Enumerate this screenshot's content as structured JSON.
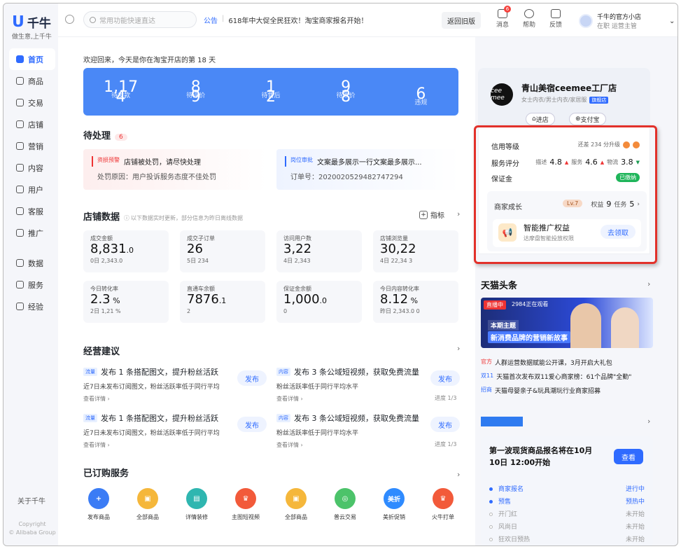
{
  "sidebar": {
    "logo_text": "千牛",
    "slogan": "做生意,上千牛",
    "items": [
      {
        "label": "首页"
      },
      {
        "label": "商品"
      },
      {
        "label": "交易"
      },
      {
        "label": "店铺"
      },
      {
        "label": "营销"
      },
      {
        "label": "内容"
      },
      {
        "label": "用户"
      },
      {
        "label": "客服"
      },
      {
        "label": "推广"
      },
      {
        "label": "数据"
      },
      {
        "label": "服务"
      },
      {
        "label": "经验"
      }
    ],
    "about": "关于千牛",
    "copyright_1": "Copyright",
    "copyright_2": "© Alibaba Group"
  },
  "topbar": {
    "search_placeholder": "常用功能快速直达",
    "notice_tag": "公告",
    "notice_text": "618年中大促全民狂欢！淘宝商家报名开始！",
    "old_version": "返回旧版",
    "messages": "消息",
    "messages_badge": "6",
    "help": "帮助",
    "feedback": "反馈",
    "user_shop": "千牛的官方小店",
    "user_status": "在职",
    "user_role": "运营主管"
  },
  "main": {
    "welcome": "欢迎回来，今天是你在淘宝开店的第 18 天",
    "banner": [
      {
        "v1": "1,17",
        "v2": "4",
        "label": "待发款"
      },
      {
        "v1": "8",
        "v2": "9",
        "label": "待评价"
      },
      {
        "v1": "1",
        "v2": "2",
        "label": "待售后"
      },
      {
        "v1": "9",
        "v2": "8",
        "label": "待改价"
      },
      {
        "v1": "6",
        "v2": "",
        "label": "违规"
      }
    ],
    "pending_title": "待处理",
    "pending_count": "6",
    "alert1": {
      "tag": "资损预警",
      "title": "店铺被处罚，请尽快处理",
      "detail": "处罚原因：用户投诉服务态度不佳处罚"
    },
    "alert2": {
      "tag": "岗位审批",
      "title": "文案最多展示一行文案最多展示...",
      "detail": "订单号：2020020529482747294"
    },
    "stats_title": "店铺数据",
    "stats_note": "以下数据实时更新，部分信息为昨日离线数据",
    "metric_btn": "指标",
    "cards": [
      {
        "label": "成交金额",
        "value": "8,831",
        "dec": ".0",
        "s1": "0",
        "s2": "日 2,343.0"
      },
      {
        "label": "成交子订单",
        "value": "26",
        "dec": "",
        "s1": "5",
        "s2": "日 234"
      },
      {
        "label": "访问用户数",
        "value": "3,22",
        "dec": "",
        "s1": "4",
        "s2": "日 2,343"
      },
      {
        "label": "店铺浏览量",
        "value": "30,22",
        "dec": "",
        "s1": "4",
        "s2": "日 22,34 3"
      },
      {
        "label": "今日转化率",
        "value": "2.3",
        "dec": " %",
        "s1": "2",
        "s2": "日 1,21 %"
      },
      {
        "label": "直通车余额",
        "value": "7876",
        "dec": ".1",
        "s1": "2",
        "s2": ""
      },
      {
        "label": "保证金余额",
        "value": "1,000",
        "dec": ".0",
        "s1": "0",
        "s2": ""
      },
      {
        "label": "今日内容转化率",
        "value": "8.12",
        "dec": " %",
        "s1": "",
        "s2": "昨日 2,343.0 0"
      }
    ],
    "advice_title": "经营建议",
    "advice": [
      {
        "tag": "流量",
        "title": "发布 1 条搭配图文，提升粉丝活跃",
        "desc": "近7日未发布订阅图文，粉丝活跃率低于同行平均",
        "more": "查看详情 ›",
        "btn": "发布"
      },
      {
        "tag": "内容",
        "title": "发布 3 条公域短视频，获取免费流量",
        "desc": "粉丝活跃率低于同行平均水平",
        "more": "查看详情 ›",
        "btn": "发布",
        "progress": "进度 1/3"
      },
      {
        "tag": "流量",
        "title": "发布 1 条搭配图文，提升粉丝活跃",
        "desc": "近7日未发布订阅图文，粉丝活跃率低于同行平均",
        "more": "查看详情 ›",
        "btn": "发布"
      },
      {
        "tag": "内容",
        "title": "发布 3 条公域短视频，获取免费流量",
        "desc": "粉丝活跃率低于同行平均水平",
        "more": "查看详情 ›",
        "btn": "发布",
        "progress": "进度 1/3"
      }
    ],
    "services_title": "已订购服务",
    "services": [
      {
        "label": "发布商品",
        "color": "#3b7cf5",
        "glyph": "+"
      },
      {
        "label": "全部商品",
        "color": "#f5b73b",
        "glyph": "▣"
      },
      {
        "label": "详情装修",
        "color": "#2fb6b0",
        "glyph": "▤"
      },
      {
        "label": "主图短视频",
        "color": "#f25a3a",
        "glyph": "♛"
      },
      {
        "label": "全部商品",
        "color": "#f5b73b",
        "glyph": "▣"
      },
      {
        "label": "普云交易",
        "color": "#4cc36a",
        "glyph": "◎"
      },
      {
        "label": "美折促销",
        "color": "#2f8bff",
        "glyph": "美折"
      },
      {
        "label": "火牛打单",
        "color": "#f25a3a",
        "glyph": "♛"
      }
    ]
  },
  "right": {
    "shop_logo": "cee mee",
    "shop_name": "青山美宿ceemee工厂店",
    "shop_cat": "女士内衣/男士内衣/家居服",
    "shop_badge": "旗舰店",
    "enter_shop": "进店",
    "alipay": "支付宝",
    "credit_label": "信用等级",
    "credit_note": "还差 234 分升级",
    "service_label": "服务评分",
    "desc_label": "描述",
    "desc_val": "4.8",
    "svc_label": "服务",
    "svc_val": "4.6",
    "logi_label": "物流",
    "logi_val": "3.8",
    "deposit_label": "保证金",
    "deposit_status": "已缴纳",
    "growth_label": "商家成长",
    "level": "Lv.7",
    "rights_label": "权益",
    "rights_val": "9",
    "tasks_label": "任务",
    "tasks_val": "5",
    "benefit_title": "智能推广权益",
    "benefit_sub": "达摩盘智能投放权限",
    "benefit_btn": "去领取",
    "tmall_title": "天猫头条",
    "live_tag": "直播中",
    "live_watch": "2984正在观看",
    "img_kicker": "本期主题",
    "img_headline": "新消费品牌的营销新故事",
    "news": [
      {
        "tag": "官方",
        "text": "人群运营数据赋能公开课，3月开启大礼包"
      },
      {
        "tag": "双11",
        "text": "天猫首次发布双11爱心商家榜：61个品牌\"全勤\""
      },
      {
        "tag": "招商",
        "text": "天猫母婴亲子&玩具潮玩行业商家招募"
      }
    ],
    "launch_title": "第一波现货商品报名将在10月10日 12:00开始",
    "launch_btn": "查看",
    "timeline": [
      {
        "label": "商家报名",
        "status": "进行中",
        "active": true
      },
      {
        "label": "预售",
        "status": "预热中",
        "active": true
      },
      {
        "label": "开门红",
        "status": "未开始",
        "active": false
      },
      {
        "label": "风尚日",
        "status": "未开始",
        "active": false
      },
      {
        "label": "狂欢日预热",
        "status": "未开始",
        "active": false
      }
    ]
  }
}
